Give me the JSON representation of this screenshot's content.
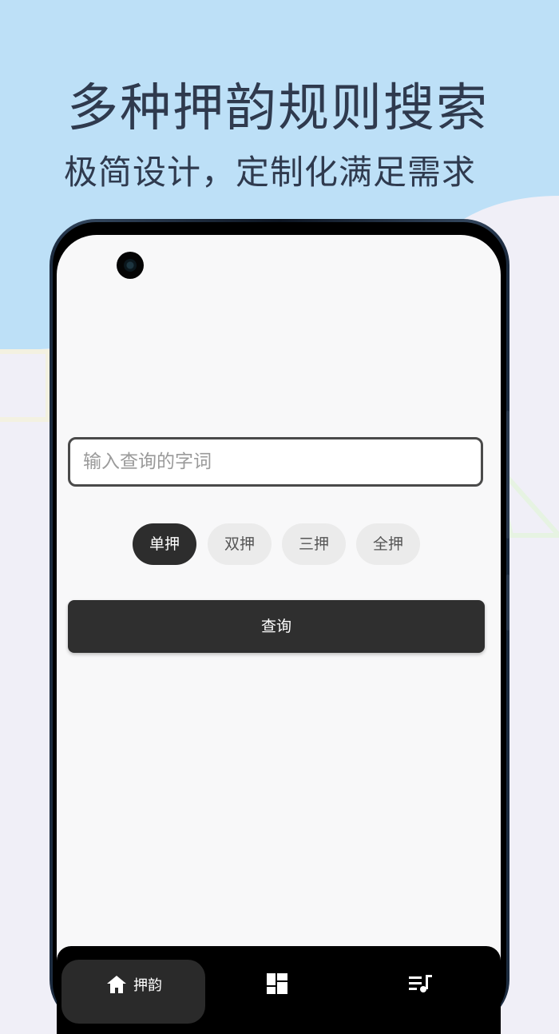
{
  "promo": {
    "headline": "多种押韵规则搜索",
    "subheadline": "极简设计，定制化满足需求"
  },
  "search": {
    "placeholder": "输入查询的字词",
    "value": ""
  },
  "rhyme_modes": [
    {
      "label": "单押",
      "selected": true
    },
    {
      "label": "双押",
      "selected": false
    },
    {
      "label": "三押",
      "selected": false
    },
    {
      "label": "全押",
      "selected": false
    }
  ],
  "query_button": {
    "label": "查询"
  },
  "bottom_nav": {
    "items": [
      {
        "label": "押韵",
        "icon": "home-icon",
        "active": true
      },
      {
        "label": "",
        "icon": "dashboard-icon",
        "active": false
      },
      {
        "label": "",
        "icon": "playlist-icon",
        "active": false
      }
    ]
  },
  "colors": {
    "background_top": "#bde0f7",
    "background_bottom": "#f0eff7",
    "headline_text": "#2f3a4e",
    "button_dark": "#2f2f2f",
    "chip_inactive": "#ebebeb"
  }
}
